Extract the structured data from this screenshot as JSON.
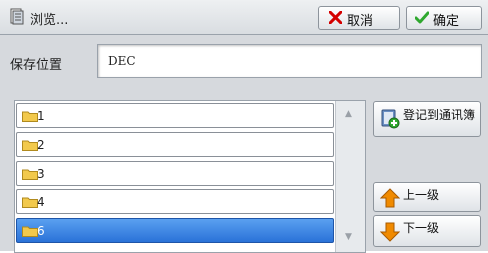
{
  "header": {
    "title": "浏览...",
    "cancel_label": "取消",
    "ok_label": "确定"
  },
  "location": {
    "label": "保存位置",
    "value": "DEC"
  },
  "folders": [
    {
      "label": "1",
      "selected": false
    },
    {
      "label": "2",
      "selected": false
    },
    {
      "label": "3",
      "selected": false
    },
    {
      "label": "4",
      "selected": false
    },
    {
      "label": "6",
      "selected": true
    }
  ],
  "actions": {
    "register_label": "登记到通讯簿",
    "up_label": "上一级",
    "down_label": "下一级"
  },
  "scroll": {
    "up_arrow": "▲",
    "down_arrow": "▼"
  },
  "colors": {
    "selected_row": "#2f7fe0",
    "folder": "#f2c94c",
    "up_arrow": "#f08a00",
    "cancel_x": "#d40000",
    "ok_check": "#2fa82f"
  }
}
